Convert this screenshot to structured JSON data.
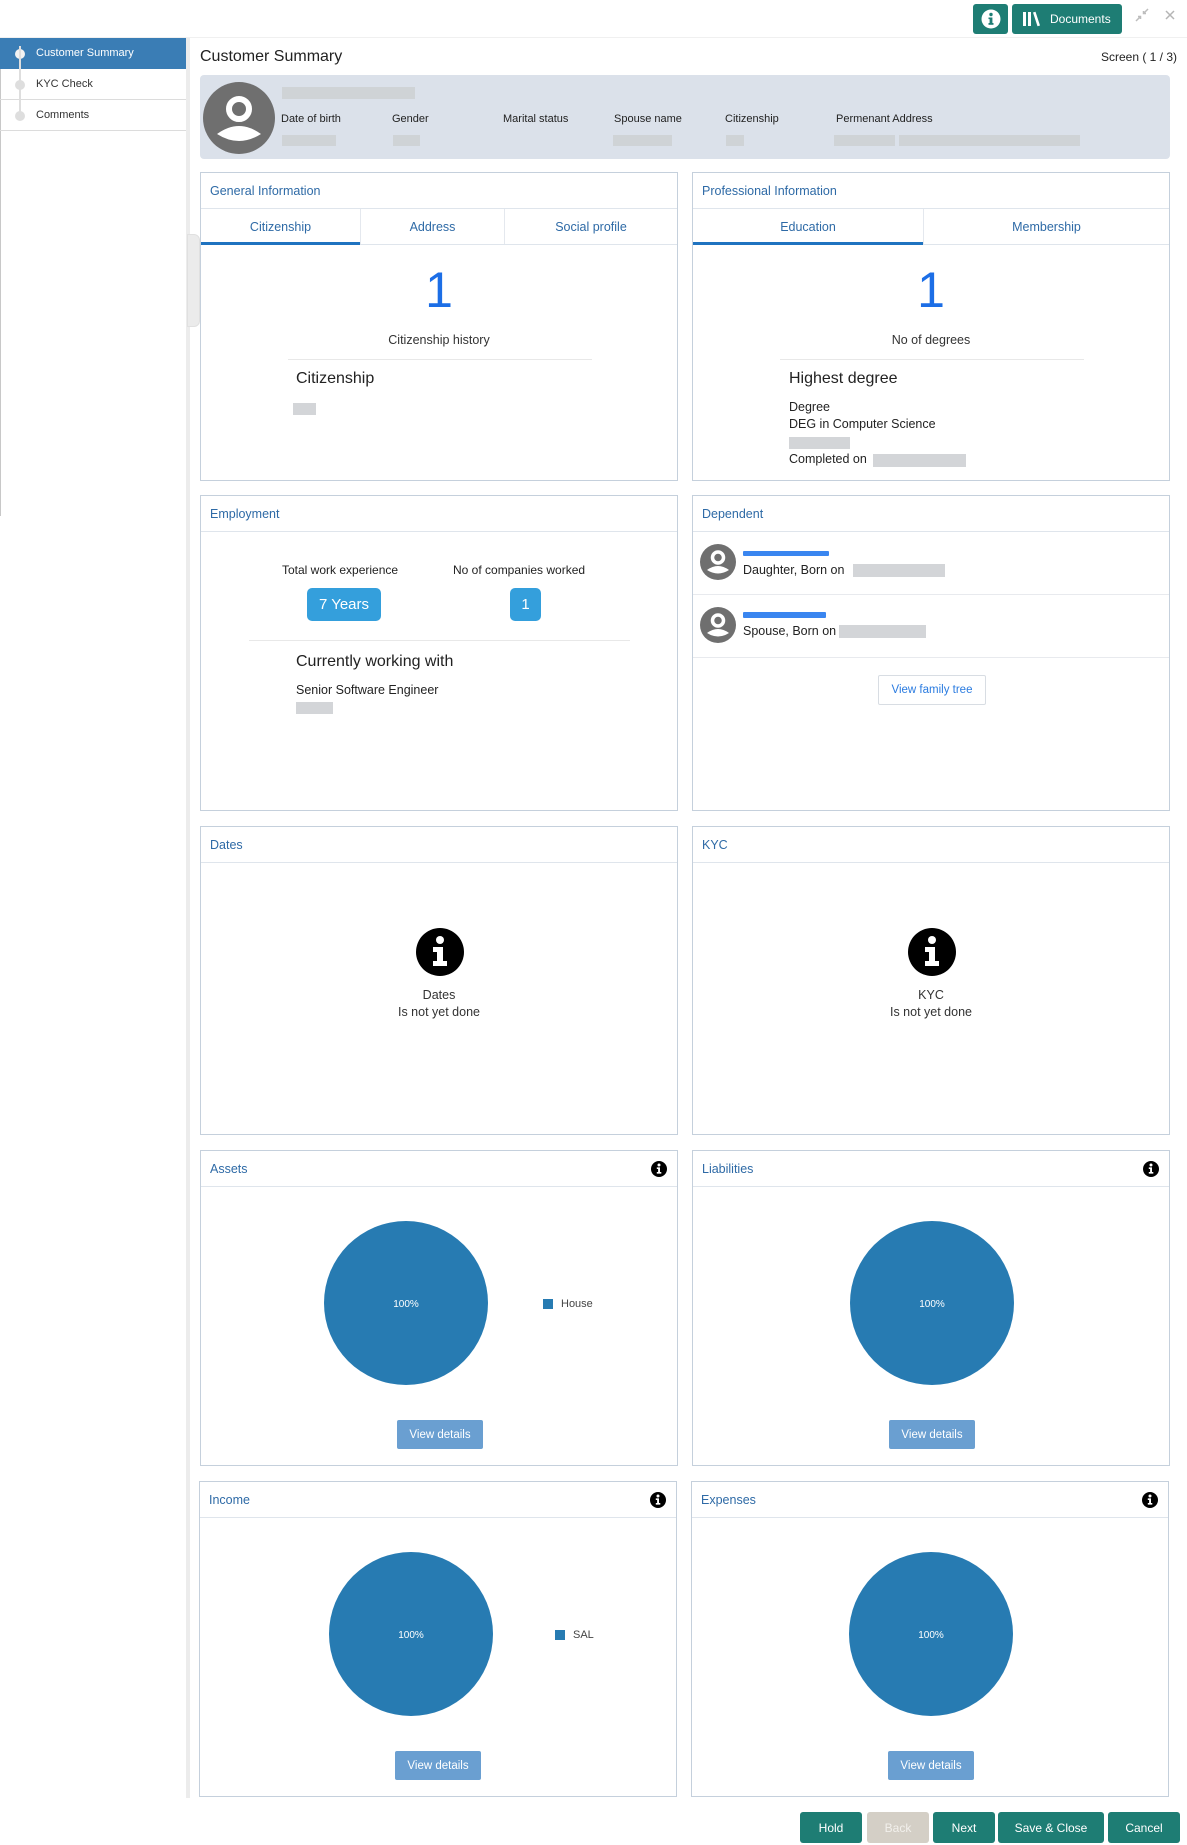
{
  "toolbar": {
    "info_icon": "info-circle-icon",
    "documents_label": "Documents",
    "documents_icon": "library-books-icon",
    "minimize_icon": "compress-arrows-icon",
    "close_icon": "close-x-icon"
  },
  "sidebar": {
    "items": [
      {
        "label": "Customer Summary",
        "active": true
      },
      {
        "label": "KYC Check",
        "active": false
      },
      {
        "label": "Comments",
        "active": false
      }
    ]
  },
  "header": {
    "title": "Customer Summary",
    "screen_indicator": "Screen ( 1 / 3)"
  },
  "profile": {
    "avatar_icon": "user-avatar-icon",
    "fields": [
      {
        "label": "Date of birth"
      },
      {
        "label": "Gender"
      },
      {
        "label": "Marital status"
      },
      {
        "label": "Spouse name"
      },
      {
        "label": "Citizenship"
      },
      {
        "label": "Permenant Address"
      }
    ]
  },
  "general_info": {
    "title": "General Information",
    "tabs": [
      {
        "label": "Citizenship",
        "active": true
      },
      {
        "label": "Address",
        "active": false
      },
      {
        "label": "Social profile",
        "active": false
      }
    ],
    "count": "1",
    "count_label": "Citizenship history",
    "section_title": "Citizenship"
  },
  "professional_info": {
    "title": "Professional Information",
    "tabs": [
      {
        "label": "Education",
        "active": true
      },
      {
        "label": "Membership",
        "active": false
      }
    ],
    "count": "1",
    "count_label": "No of degrees",
    "section_title": "Highest degree",
    "degree_label": "Degree",
    "degree_value": "DEG in Computer Science",
    "completed_label": "Completed on"
  },
  "employment": {
    "title": "Employment",
    "experience_label": "Total work experience",
    "experience_value": "7 Years",
    "companies_label": "No of companies worked",
    "companies_value": "1",
    "section_title": "Currently working with",
    "designation": "Senior Software Engineer"
  },
  "dependent": {
    "title": "Dependent",
    "items": [
      {
        "relation_text": "Daughter, Born on"
      },
      {
        "relation_text": "Spouse, Born on"
      }
    ],
    "view_tree_label": "View family tree"
  },
  "dates": {
    "title": "Dates",
    "status_title": "Dates",
    "status_text": "Is not yet done"
  },
  "kyc": {
    "title": "KYC",
    "status_title": "KYC",
    "status_text": "Is not yet done"
  },
  "financial_cards": {
    "view_details_label": "View details",
    "pie_color": "#277bb2"
  },
  "chart_data": [
    {
      "type": "pie",
      "title": "Assets",
      "categories": [
        "House"
      ],
      "values": [
        100
      ],
      "labels": [
        "100%"
      ],
      "legend": "right"
    },
    {
      "type": "pie",
      "title": "Liabilities",
      "categories": [
        ""
      ],
      "values": [
        100
      ],
      "labels": [
        "100%"
      ],
      "legend": "none"
    },
    {
      "type": "pie",
      "title": "Income",
      "categories": [
        "SAL"
      ],
      "values": [
        100
      ],
      "labels": [
        "100%"
      ],
      "legend": "right"
    },
    {
      "type": "pie",
      "title": "Expenses",
      "categories": [
        ""
      ],
      "values": [
        100
      ],
      "labels": [
        "100%"
      ],
      "legend": "none"
    }
  ],
  "footer": {
    "hold": "Hold",
    "back": "Back",
    "next": "Next",
    "save_close": "Save & Close",
    "cancel": "Cancel"
  },
  "colors": {
    "primary_teal": "#1e7d74",
    "sidebar_active": "#3a7db5",
    "accent_blue": "#1c6ee6",
    "pill_blue": "#349fdc"
  }
}
